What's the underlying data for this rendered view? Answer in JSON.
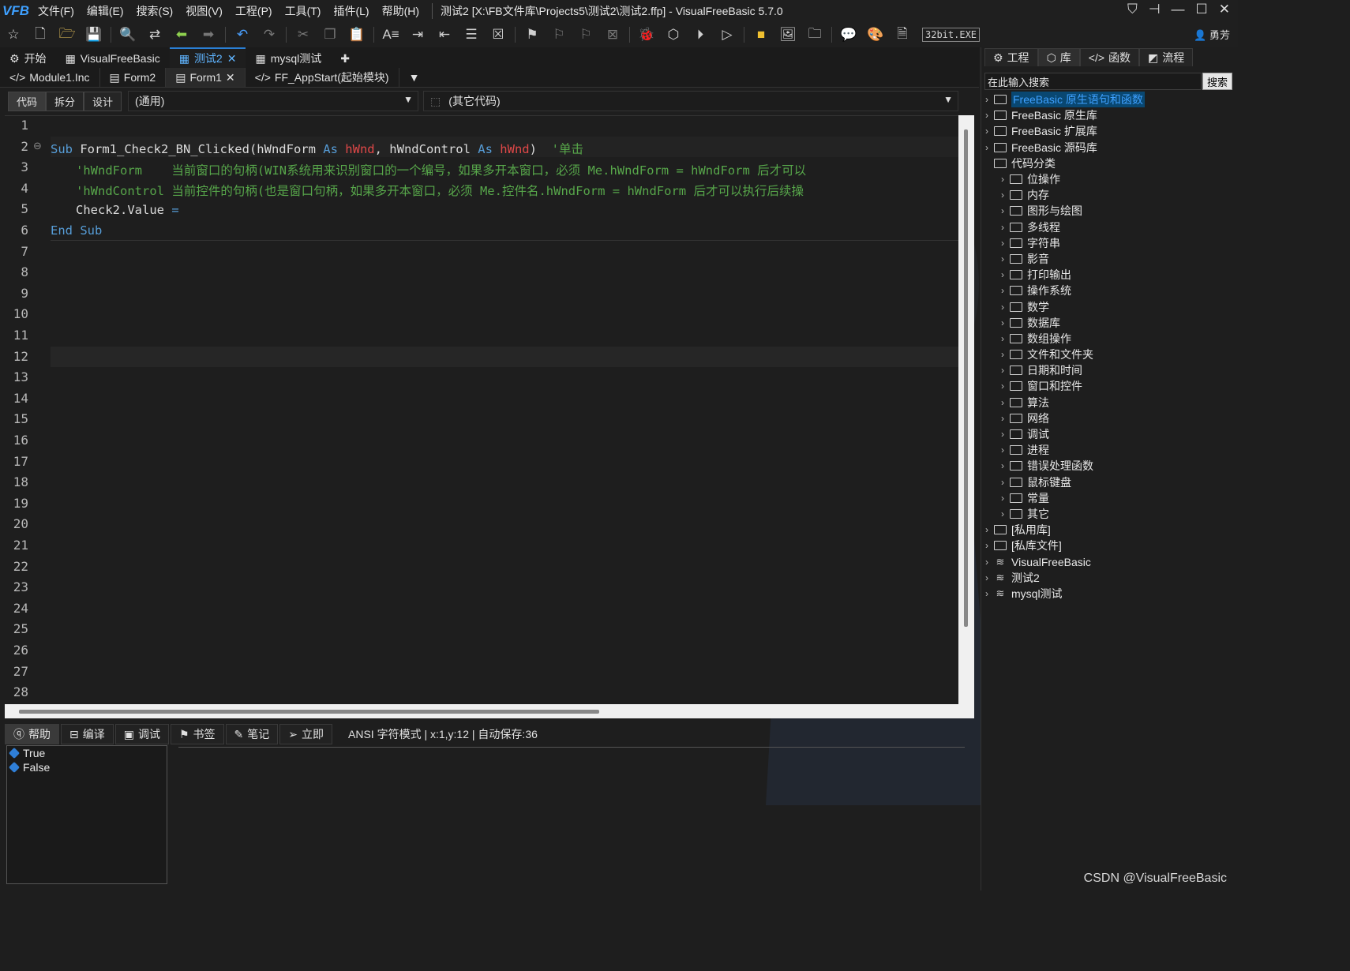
{
  "app": {
    "logo": "VFB",
    "title": "测试2 [X:\\FB文件库\\Projects5\\测试2\\测试2.ffp] - VisualFreeBasic 5.7.0",
    "menu": [
      "文件(F)",
      "编辑(E)",
      "搜索(S)",
      "视图(V)",
      "工程(P)",
      "工具(T)",
      "插件(L)",
      "帮助(H)"
    ],
    "window_buttons": [
      "shirt-icon",
      "pin-icon",
      "minimize-icon",
      "maximize-icon",
      "close-icon"
    ]
  },
  "toolbar": {
    "badge": "32bit.EXE",
    "user": "勇芳",
    "icons": [
      "star-icon",
      "new-file-icon",
      "open-folder-icon",
      "save-icon",
      "find-icon",
      "replace-icon",
      "back-icon",
      "forward-icon",
      "undo-icon",
      "redo-icon",
      "cut-icon",
      "copy-icon",
      "paste-icon",
      "format-icon",
      "indent-icon",
      "outdent-icon",
      "list-icon",
      "clear-list-icon",
      "bookmark-icon",
      "bookmark-prev-icon",
      "bookmark-next-icon",
      "bookmark-clear-icon",
      "debug-icon",
      "cube-icon",
      "run-circle-icon",
      "run-icon",
      "package-icon",
      "image-icon",
      "folder-icon",
      "chat-icon",
      "palette-icon",
      "vfb-file-icon"
    ]
  },
  "doc_tabs": [
    {
      "label": "开始",
      "active": false
    },
    {
      "label": "VisualFreeBasic",
      "active": false
    },
    {
      "label": "测试2",
      "active": true
    },
    {
      "label": "mysql测试",
      "active": false
    }
  ],
  "file_tabs": [
    {
      "label": "Module1.Inc",
      "active": false
    },
    {
      "label": "Form2",
      "active": false
    },
    {
      "label": "Form1",
      "active": true
    },
    {
      "label": "FF_AppStart(起始模块)",
      "active": false
    }
  ],
  "mode_buttons": [
    "代码",
    "拆分",
    "设计"
  ],
  "combo_left": "(通用)",
  "combo_right": "(其它代码)",
  "code": {
    "line_numbers": [
      "1",
      "2",
      "3",
      "4",
      "5",
      "6",
      "7",
      "8",
      "9",
      "10",
      "11",
      "12",
      "13",
      "14",
      "15",
      "16",
      "17",
      "18",
      "19",
      "20",
      "21",
      "22",
      "23",
      "24",
      "25",
      "26",
      "27",
      "28"
    ],
    "line2": {
      "sub": "Sub",
      "name": " Form1_Check2_BN_Clicked(hWndForm ",
      "as1": "As",
      "sp1": " ",
      "hwnd1": "hWnd",
      "mid": ", hWndControl ",
      "as2": "As",
      "sp2": " ",
      "hwnd2": "hWnd",
      "end": ")  ",
      "comment": "'单击"
    },
    "line3": "'hWndForm    当前窗口的句柄(WIN系统用来识别窗口的一个编号，如果多开本窗口，必须 Me.hWndForm = hWndForm 后才可以",
    "line4": "'hWndControl 当前控件的句柄(也是窗口句柄，如果多开本窗口，必须 Me.控件名.hWndForm = hWndForm 后才可以执行后续操",
    "line5_a": "Check2.Value ",
    "line5_b": "=",
    "line6_a": "End",
    "line6_b": "Sub"
  },
  "bottom_tabs": [
    "帮助",
    "编译",
    "调试",
    "书签",
    "笔记",
    "立即"
  ],
  "status": "ANSI 字符模式 | x:1,y:12 | 自动保存:36",
  "help_items": [
    "True",
    "False"
  ],
  "right_tabs": [
    "工程",
    "库",
    "函数",
    "流程"
  ],
  "search": {
    "placeholder": "在此输入搜索",
    "button": "搜索"
  },
  "tree": {
    "top": [
      "FreeBasic 原生语句和函数",
      "FreeBasic 原生库",
      "FreeBasic 扩展库",
      "FreeBasic 源码库"
    ],
    "category": "代码分类",
    "children": [
      "位操作",
      "内存",
      "图形与绘图",
      "多线程",
      "字符串",
      "影音",
      "打印输出",
      "操作系统",
      "数学",
      "数据库",
      "数组操作",
      "文件和文件夹",
      "日期和时间",
      "窗口和控件",
      "算法",
      "网络",
      "调试",
      "进程",
      "错误处理函数",
      "鼠标键盘",
      "常量",
      "其它"
    ],
    "tail": [
      "[私用库]",
      "[私库文件]"
    ],
    "projects": [
      "VisualFreeBasic",
      "测试2",
      "mysql测试"
    ]
  },
  "watermark": "CSDN @VisualFreeBasic",
  "colors": {
    "accent": "#3ea0ff",
    "keyword": "#569cd6",
    "type": "#e04848",
    "comment": "#57a64a",
    "background": "#1e1e1e"
  }
}
